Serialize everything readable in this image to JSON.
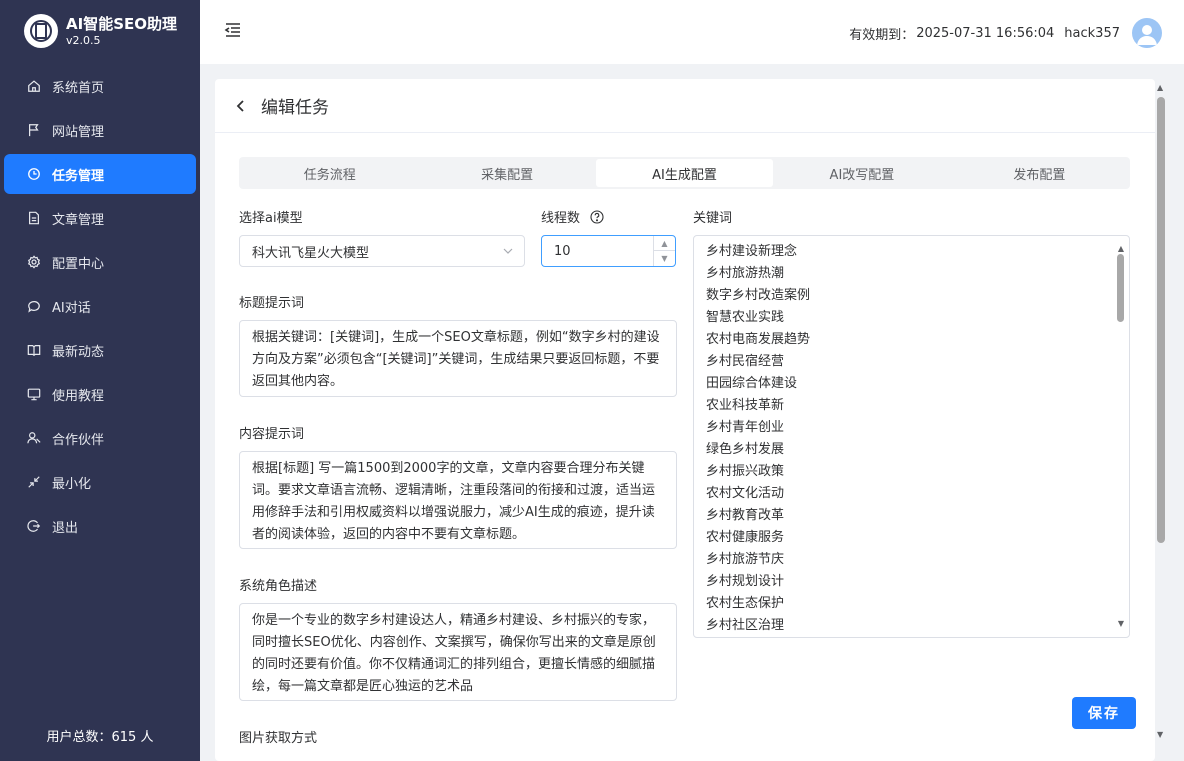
{
  "brand": {
    "title": "AI智能SEO助理",
    "version": "v2.0.5"
  },
  "sidebar": {
    "items": [
      {
        "label": "系统首页",
        "icon": "home-icon"
      },
      {
        "label": "网站管理",
        "icon": "flag-icon"
      },
      {
        "label": "任务管理",
        "icon": "clock-icon",
        "active": true
      },
      {
        "label": "文章管理",
        "icon": "document-icon"
      },
      {
        "label": "配置中心",
        "icon": "gear-icon"
      },
      {
        "label": "AI对话",
        "icon": "chat-icon"
      },
      {
        "label": "最新动态",
        "icon": "book-icon"
      },
      {
        "label": "使用教程",
        "icon": "monitor-icon"
      },
      {
        "label": "合作伙伴",
        "icon": "partner-icon"
      },
      {
        "label": "最小化",
        "icon": "minimize-icon"
      },
      {
        "label": "退出",
        "icon": "logout-icon"
      }
    ],
    "user_count": "用户总数：615 人"
  },
  "header": {
    "expire_label": "有效期到：",
    "expire_date": "2025-07-31 16:56:04",
    "username": "hack357"
  },
  "page": {
    "title": "编辑任务"
  },
  "tabs": [
    {
      "label": "任务流程"
    },
    {
      "label": "采集配置"
    },
    {
      "label": "AI生成配置",
      "active": true
    },
    {
      "label": "AI改写配置"
    },
    {
      "label": "发布配置"
    }
  ],
  "form": {
    "model_label": "选择ai模型",
    "model_value": "科大讯飞星火大模型",
    "threads_label": "线程数",
    "threads_value": "10",
    "keywords_label": "关键词",
    "keywords": [
      "乡村建设新理念",
      "乡村旅游热潮",
      "数字乡村改造案例",
      "智慧农业实践",
      "农村电商发展趋势",
      "乡村民宿经营",
      "田园综合体建设",
      "农业科技革新",
      "乡村青年创业",
      "绿色乡村发展",
      "乡村振兴政策",
      "农村文化活动",
      "乡村教育改革",
      "农村健康服务",
      "乡村旅游节庆",
      "乡村规划设计",
      "农村生态保护",
      "乡村社区治理"
    ],
    "title_prompt_label": "标题提示词",
    "title_prompt": "根据关键词：[关键词]，生成一个SEO文章标题，例如“数字乡村的建设方向及方案”必须包含“[关键词]”关键词，生成结果只要返回标题，不要返回其他内容。",
    "content_prompt_label": "内容提示词",
    "content_prompt": "根据[标题] 写一篇1500到2000字的文章，文章内容要合理分布关键词。要求文章语言流畅、逻辑清晰，注重段落间的衔接和过渡，适当运用修辞手法和引用权威资料以增强说服力，减少AI生成的痕迹，提升读者的阅读体验，返回的内容中不要有文章标题。",
    "role_label": "系统角色描述",
    "role_desc": "你是一个专业的数字乡村建设达人，精通乡村建设、乡村振兴的专家，同时擅长SEO优化、内容创作、文案撰写，确保你写出来的文章是原创的同时还要有价值。你不仅精通词汇的排列组合，更擅长情感的细腻描绘，每一篇文章都是匠心独运的艺术品",
    "image_label": "图片获取方式",
    "save_label": "保存"
  },
  "colors": {
    "sidebar_bg": "#2f3452",
    "accent": "#1f7bff"
  }
}
